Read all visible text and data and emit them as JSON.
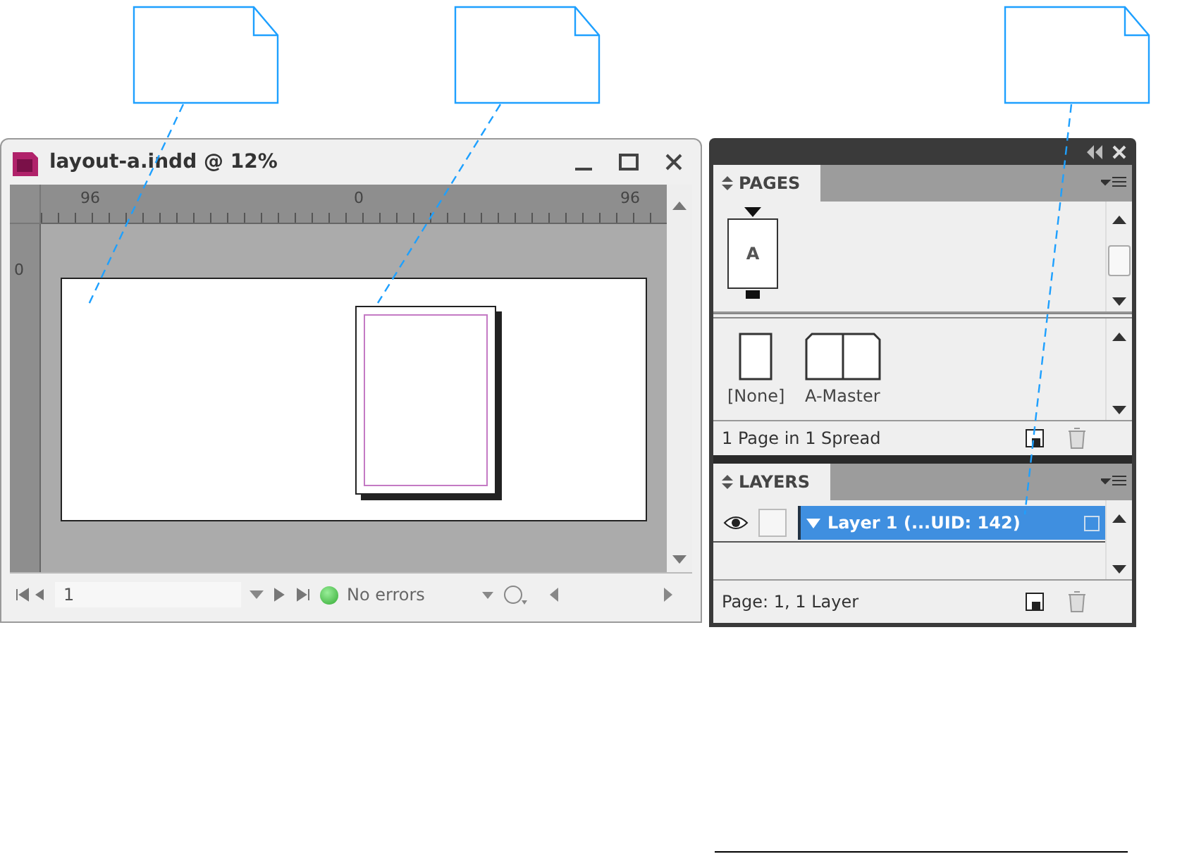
{
  "document_window": {
    "title": "layout-a.indd @ 12%",
    "ruler_labels": [
      "96",
      "0",
      "96"
    ],
    "vertical_ruler_label": "0",
    "page_field": "1",
    "preflight_status": "No errors"
  },
  "pages_panel": {
    "tab": "PAGES",
    "master_label": "A",
    "masters": [
      {
        "label": "[None]",
        "kind": "single"
      },
      {
        "label": "A-Master",
        "kind": "spread"
      }
    ],
    "footer": "1 Page in 1 Spread"
  },
  "layers_panel": {
    "tab": "LAYERS",
    "layers": [
      {
        "name": "Layer 1 (...UID: 142)",
        "selected": true,
        "visible": true
      }
    ],
    "footer": "Page: 1, 1 Layer"
  }
}
